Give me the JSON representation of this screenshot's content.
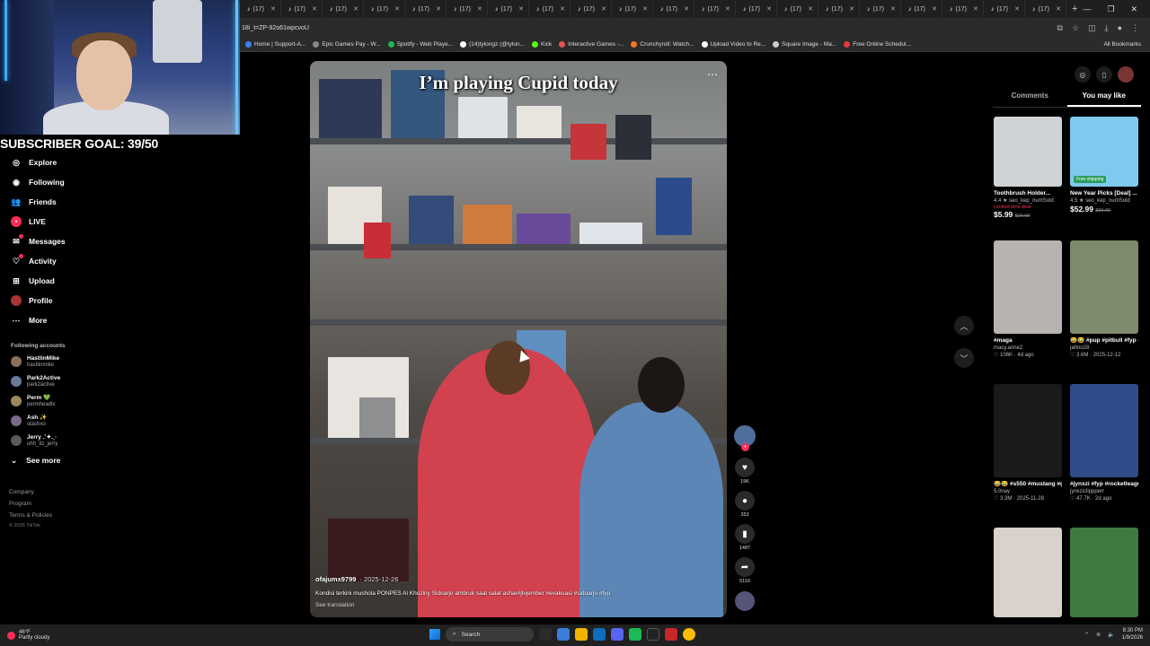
{
  "browser": {
    "tabs": [
      "(17)",
      "(17)",
      "(17)",
      "(17)",
      "(17)",
      "(17)",
      "(17)",
      "(17)",
      "(17)",
      "(17)",
      "(17)",
      "(17)",
      "(17)",
      "(17)",
      "(17)",
      "(17)",
      "(17)",
      "(17)",
      "(17)",
      "(17)"
    ],
    "url": "18i_t=ZP-92o61wpcvoU",
    "bookmarks": [
      {
        "label": "Home | Support-A...",
        "color": "#3b82f6"
      },
      {
        "label": "Epic Games Pay - W...",
        "color": "#888888"
      },
      {
        "label": "Spotify - Web Playe...",
        "color": "#1db954"
      },
      {
        "label": "(14)tylongz (@tylon...",
        "color": "#ffffff"
      },
      {
        "label": "Kick",
        "color": "#53fc18"
      },
      {
        "label": "Interactive Games -...",
        "color": "#e25555"
      },
      {
        "label": "Crunchyroll: Watch...",
        "color": "#f47521"
      },
      {
        "label": "Upload Video to Re...",
        "color": "#ffffff"
      },
      {
        "label": "Square Image - Ma...",
        "color": "#cccccc"
      },
      {
        "label": "Free Online Schedul...",
        "color": "#e33b3b"
      }
    ],
    "all_bookmarks": "All Bookmarks"
  },
  "overlay": {
    "subscriber_goal": "SUBSCRIBER GOAL: 39/50"
  },
  "nav": {
    "items": [
      {
        "label": "Explore",
        "icon": "compass-icon"
      },
      {
        "label": "Following",
        "icon": "following-icon"
      },
      {
        "label": "Friends",
        "icon": "friends-icon"
      },
      {
        "label": "LIVE",
        "icon": "live-icon"
      },
      {
        "label": "Messages",
        "icon": "messages-icon"
      },
      {
        "label": "Activity",
        "icon": "activity-icon"
      },
      {
        "label": "Upload",
        "icon": "upload-icon"
      },
      {
        "label": "Profile",
        "icon": "profile-icon"
      },
      {
        "label": "More",
        "icon": "more-icon"
      }
    ],
    "following_header": "Following accounts",
    "accounts": [
      {
        "name": "HastlinMike",
        "handle": "hastlinmike"
      },
      {
        "name": "Park2Active",
        "handle": "park2active"
      },
      {
        "name": "Perm 💚",
        "handle": "permheadtv"
      },
      {
        "name": "Ash ✨",
        "handle": "stashxo"
      },
      {
        "name": "Jerry .˚✦.˳·",
        "handle": "uhh_itz_jerry"
      }
    ],
    "see_more": "See more",
    "footer": [
      "Company",
      "Program",
      "Terms & Policies"
    ],
    "copyright": "© 2026 TikTok"
  },
  "video": {
    "title_overlay": "I’m playing Cupid today",
    "username": "ofajumx9799",
    "date": "· 2025-12-26",
    "caption": "Kondisi terkini mushola PONPES Al Khoziny Sidoarjo ambruk saat salat ashar#jtvjember #evakuasi #sidoarjo #fyp",
    "see_translation": "See translation",
    "likes": "19K",
    "comments": "353",
    "saves": "1487",
    "shares": "5110"
  },
  "right_panel": {
    "tabs": [
      "Comments",
      "You may like"
    ],
    "active_tab": "You may like",
    "cards": [
      {
        "title": "Toothbrush Holder...",
        "rating": "4.4 ★",
        "sold": "seo_kep_numSold",
        "badge": "Limited time deal",
        "price": "$5.99",
        "old_price": "$29.99",
        "color": "#cfd3d6"
      },
      {
        "title": "New Year Picks [Deal] ...",
        "rating": "4.5 ★",
        "sold": "seo_kep_numSold",
        "badge": "Free shipping",
        "price": "$52.99",
        "old_price": "$89.99",
        "color": "#7fc9ef"
      },
      {
        "title": "#maga",
        "author": "macy.anne2",
        "stats": "♡ 106K · 4d ago",
        "color": "#b7b3b0"
      },
      {
        "title": "😂😂 #pup #pitbull #fyp #dog",
        "author": "jahno28",
        "stats": "♡ 3.6M · 2025-12-12",
        "color": "#7d8a6c"
      },
      {
        "title": "😂😂 #s550 #mustang #g...",
        "author": "5.0nay",
        "stats": "♡ 3.3M · 2025-11-28",
        "color": "#1a1a1a"
      },
      {
        "title": "#jynxzi #fyp #rocketleague...",
        "author": "jynxziclippperr",
        "stats": "♡ 47.7K · 2d ago",
        "color": "#2f4d8a"
      },
      {
        "title": "",
        "author": "",
        "stats": "",
        "color": "#d8d2ca"
      },
      {
        "title": "",
        "author": "",
        "stats": "",
        "color": "#3f7a3f"
      }
    ]
  },
  "taskbar": {
    "temp": "46°F",
    "weather": "Partly cloudy",
    "search": "Search",
    "time": "8:30 PM",
    "date": "1/9/2026"
  }
}
